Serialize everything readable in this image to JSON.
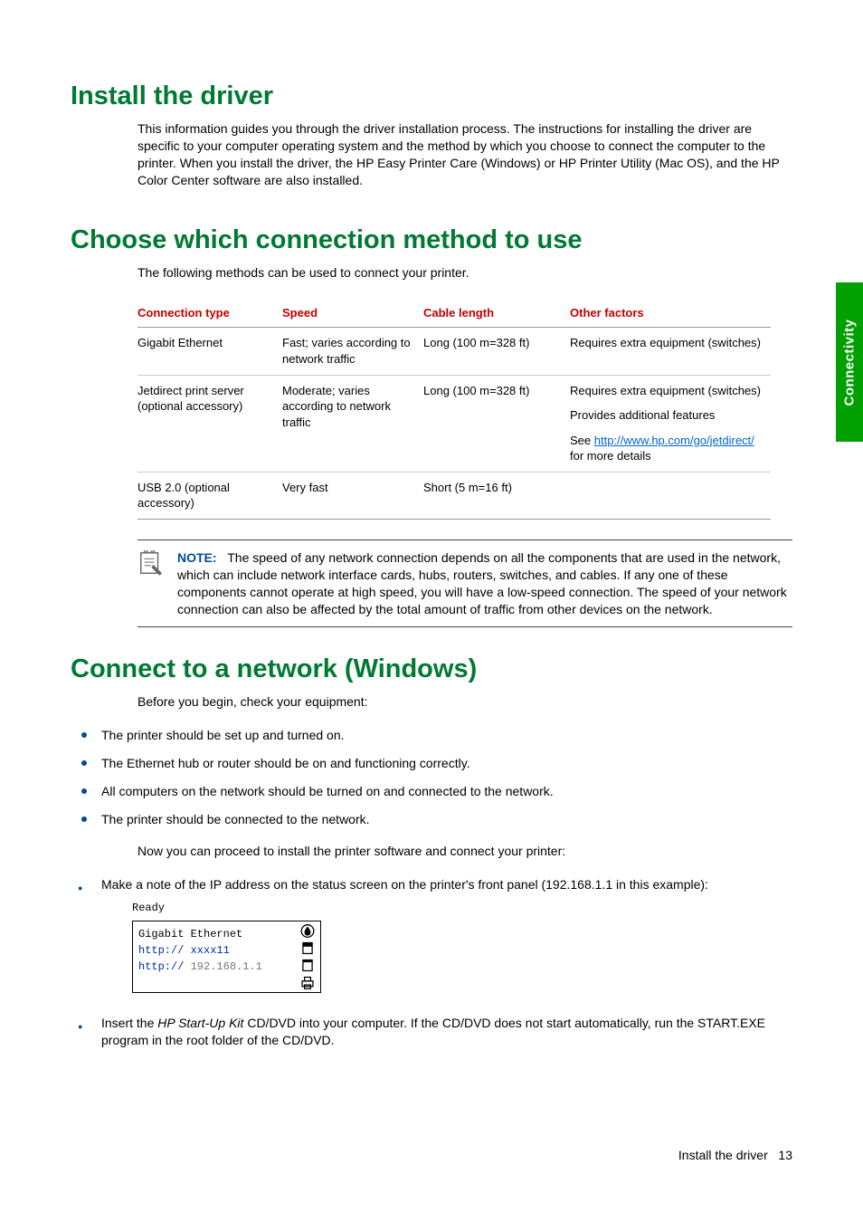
{
  "sidebar": {
    "label": "Connectivity"
  },
  "sections": {
    "install": {
      "title": "Install the driver",
      "p1": "This information guides you through the driver installation process. The instructions for installing the driver are specific to your computer operating system and the method by which you choose to connect the computer to the printer. When you install the driver, the HP Easy Printer Care (Windows) or HP Printer Utility (Mac OS), and the HP Color Center software are also installed."
    },
    "choose": {
      "title": "Choose which connection method to use",
      "p1": "The following methods can be used to connect your printer.",
      "table": {
        "headers": [
          "Connection type",
          "Speed",
          "Cable length",
          "Other factors"
        ],
        "rows": [
          {
            "type": "Gigabit Ethernet",
            "speed": "Fast; varies according to network traffic",
            "length": "Long (100 m=328 ft)",
            "other": [
              "Requires extra equipment (switches)"
            ]
          },
          {
            "type": "Jetdirect print server (optional accessory)",
            "speed": "Moderate; varies according to network traffic",
            "length": "Long (100 m=328 ft)",
            "other_pre": "Requires extra equipment (switches)",
            "other_mid": "Provides additional features",
            "other_see": "See ",
            "other_link": "http://www.hp.com/go/jetdirect/",
            "other_suffix": " for more details"
          },
          {
            "type": "USB 2.0 (optional accessory)",
            "speed": "Very fast",
            "length": "Short (5 m=16 ft)",
            "other": [
              ""
            ]
          }
        ]
      },
      "note": {
        "label": "NOTE:",
        "text": "The speed of any network connection depends on all the components that are used in the network, which can include network interface cards, hubs, routers, switches, and cables. If any one of these components cannot operate at high speed, you will have a low-speed connection. The speed of your network connection can also be affected by the total amount of traffic from other devices on the network."
      }
    },
    "connect_win": {
      "title": "Connect to a network (Windows)",
      "p1": "Before you begin, check your equipment:",
      "bullets": [
        "The printer should be set up and turned on.",
        "The Ethernet hub or router should be on and functioning correctly.",
        "All computers on the network should be turned on and connected to the network.",
        "The printer should be connected to the network."
      ],
      "p2": "Now you can proceed to install the printer software and connect your printer:",
      "steps": {
        "s1": "Make a note of the IP address on the status screen on the printer's front panel (192.168.1.1 in this example):",
        "panel_ready": "Ready",
        "panel_lines": {
          "l1": "Gigabit Ethernet",
          "l2": "http:// xxxx11",
          "l3a": "http:// ",
          "l3b": "192.168.1.1"
        },
        "s2_a": "Insert the ",
        "s2_i": "HP Start-Up Kit",
        "s2_b": " CD/DVD into your computer. If the CD/DVD does not start automatically, run the START.EXE program in the root folder of the CD/DVD."
      }
    }
  },
  "footer": {
    "text": "Install the driver",
    "page": "13"
  }
}
